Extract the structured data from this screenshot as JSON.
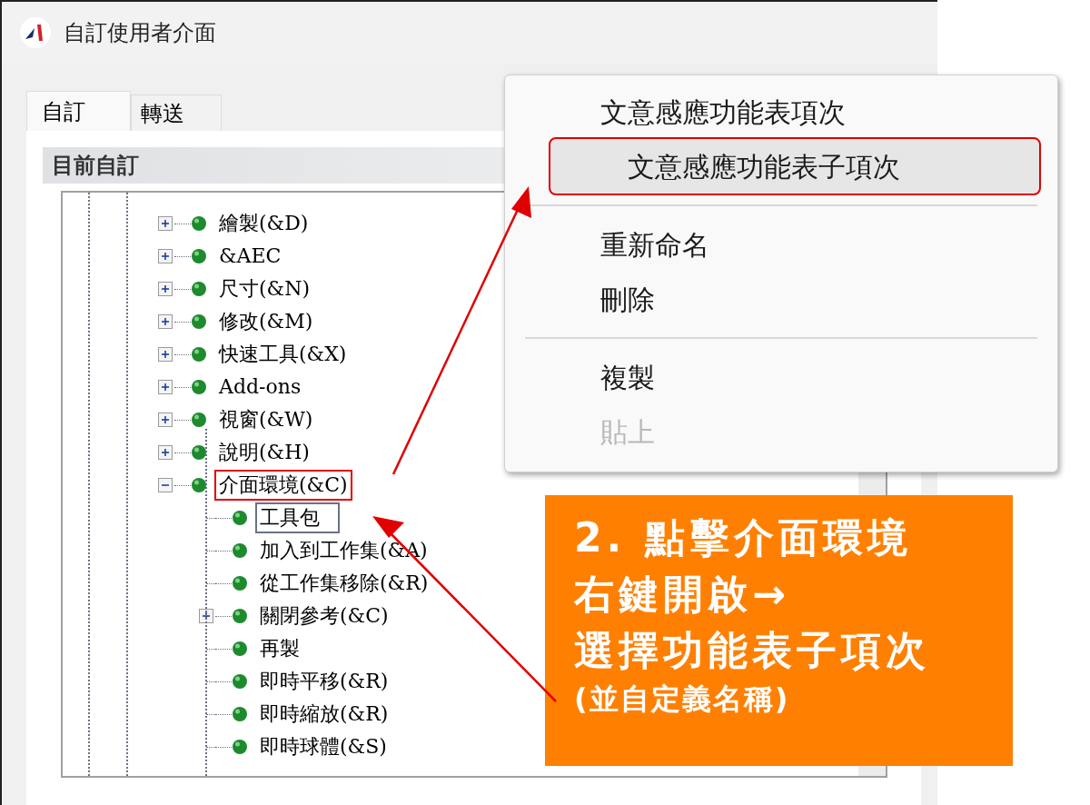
{
  "window": {
    "title": "自訂使用者介面"
  },
  "tabs": [
    {
      "label": "自訂",
      "selected": true
    },
    {
      "label": "轉送",
      "selected": false
    }
  ],
  "panel": {
    "title": "目前自訂"
  },
  "tree": [
    {
      "label": "繪製(&D)",
      "expandable": true,
      "expanded": false,
      "annotated": false,
      "editing": false
    },
    {
      "label": "&AEC",
      "expandable": true,
      "expanded": false,
      "annotated": false,
      "editing": false
    },
    {
      "label": "尺寸(&N)",
      "expandable": true,
      "expanded": false,
      "annotated": false,
      "editing": false
    },
    {
      "label": "修改(&M)",
      "expandable": true,
      "expanded": false,
      "annotated": false,
      "editing": false
    },
    {
      "label": "快速工具(&X)",
      "expandable": true,
      "expanded": false,
      "annotated": false,
      "editing": false
    },
    {
      "label": "Add-ons",
      "expandable": true,
      "expanded": false,
      "annotated": false,
      "editing": false
    },
    {
      "label": "視窗(&W)",
      "expandable": true,
      "expanded": false,
      "annotated": false,
      "editing": false
    },
    {
      "label": "說明(&H)",
      "expandable": true,
      "expanded": false,
      "annotated": false,
      "editing": false
    },
    {
      "label": "介面環境(&C)",
      "expandable": true,
      "expanded": true,
      "annotated": true,
      "editing": false,
      "children": [
        {
          "label": "工具包",
          "expandable": false,
          "expanded": false,
          "annotated": false,
          "editing": true
        },
        {
          "label": "加入到工作集(&A)",
          "expandable": false,
          "expanded": false,
          "annotated": false,
          "editing": false
        },
        {
          "label": "從工作集移除(&R)",
          "expandable": false,
          "expanded": false,
          "annotated": false,
          "editing": false
        },
        {
          "label": "關閉參考(&C)",
          "expandable": true,
          "expanded": false,
          "annotated": false,
          "editing": false
        },
        {
          "label": "再製",
          "expandable": false,
          "expanded": false,
          "annotated": false,
          "editing": false
        },
        {
          "label": "即時平移(&R)",
          "expandable": false,
          "expanded": false,
          "annotated": false,
          "editing": false
        },
        {
          "label": "即時縮放(&R)",
          "expandable": false,
          "expanded": false,
          "annotated": false,
          "editing": false
        },
        {
          "label": "即時球體(&S)",
          "expandable": false,
          "expanded": false,
          "annotated": false,
          "editing": false
        }
      ]
    }
  ],
  "context_menu": [
    {
      "kind": "item",
      "label": "文意感應功能表項次",
      "disabled": false,
      "highlighted": false,
      "annotated": false
    },
    {
      "kind": "item",
      "label": "文意感應功能表子項次",
      "disabled": false,
      "highlighted": true,
      "annotated": true
    },
    {
      "kind": "separator"
    },
    {
      "kind": "item",
      "label": "重新命名",
      "disabled": false,
      "highlighted": false,
      "annotated": false
    },
    {
      "kind": "item",
      "label": "刪除",
      "disabled": false,
      "highlighted": false,
      "annotated": false
    },
    {
      "kind": "separator"
    },
    {
      "kind": "item",
      "label": "複製",
      "disabled": false,
      "highlighted": false,
      "annotated": false
    },
    {
      "kind": "item",
      "label": "貼上",
      "disabled": true,
      "highlighted": false,
      "annotated": false
    }
  ],
  "callout": {
    "lines": [
      {
        "kind": "heading",
        "text": "2. 點擊介面環境"
      },
      {
        "kind": "heading",
        "text": "右鍵開啟→"
      },
      {
        "kind": "heading",
        "text": "選擇功能表子項次"
      },
      {
        "kind": "note",
        "text": "(並自定義名稱)"
      }
    ]
  }
}
